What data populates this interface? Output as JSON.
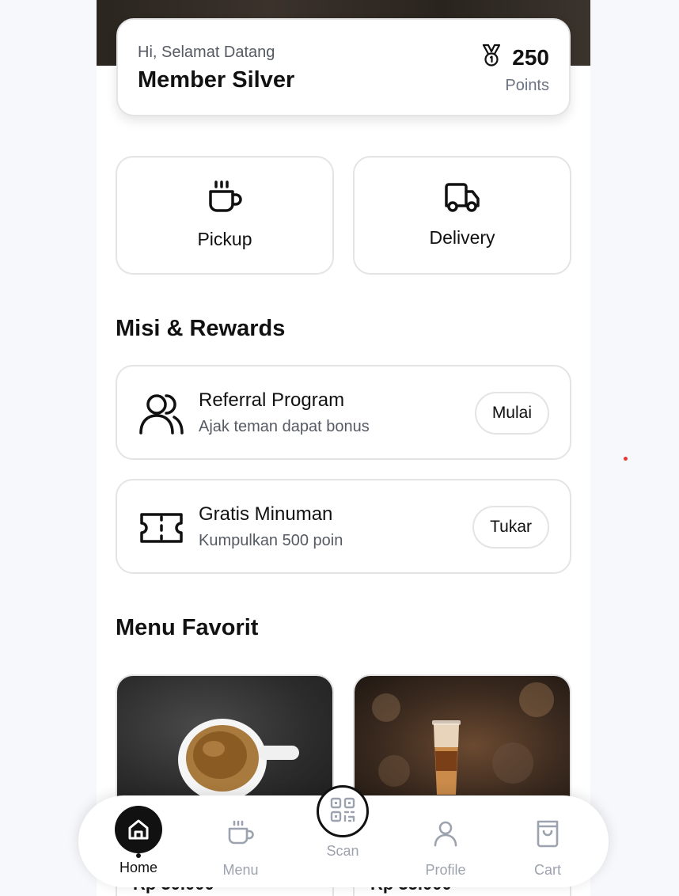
{
  "member": {
    "greeting": "Hi, Selamat Datang",
    "tier": "Member Silver",
    "points": "250",
    "points_label": "Points",
    "points_icon": "medal-icon"
  },
  "actions": [
    {
      "label": "Pickup",
      "icon": "coffee-cup-icon"
    },
    {
      "label": "Delivery",
      "icon": "truck-icon"
    }
  ],
  "missions": {
    "title": "Misi & Rewards",
    "items": [
      {
        "title": "Referral Program",
        "subtitle": "Ajak teman dapat bonus",
        "button": "Mulai",
        "icon": "users-icon"
      },
      {
        "title": "Gratis Minuman",
        "subtitle": "Kumpulkan 500 poin",
        "button": "Tukar",
        "icon": "ticket-icon"
      }
    ]
  },
  "favorites": {
    "title": "Menu Favorit",
    "items": [
      {
        "image": "espresso-cup",
        "price": "Rp 30.000"
      },
      {
        "image": "iced-coffee-glass",
        "price": "Rp 35.000"
      }
    ]
  },
  "nav": {
    "items": [
      {
        "label": "Home",
        "icon": "home-icon",
        "active": true
      },
      {
        "label": "Menu",
        "icon": "coffee-cup-icon"
      },
      {
        "label": "Scan",
        "icon": "qr-code-icon"
      },
      {
        "label": "Profile",
        "icon": "user-icon"
      },
      {
        "label": "Cart",
        "icon": "shopping-bag-icon"
      }
    ]
  },
  "colors": {
    "accent": "#111111",
    "muted_text": "#6b7280",
    "border": "#e4e4e7",
    "indicator": "#e53935"
  }
}
